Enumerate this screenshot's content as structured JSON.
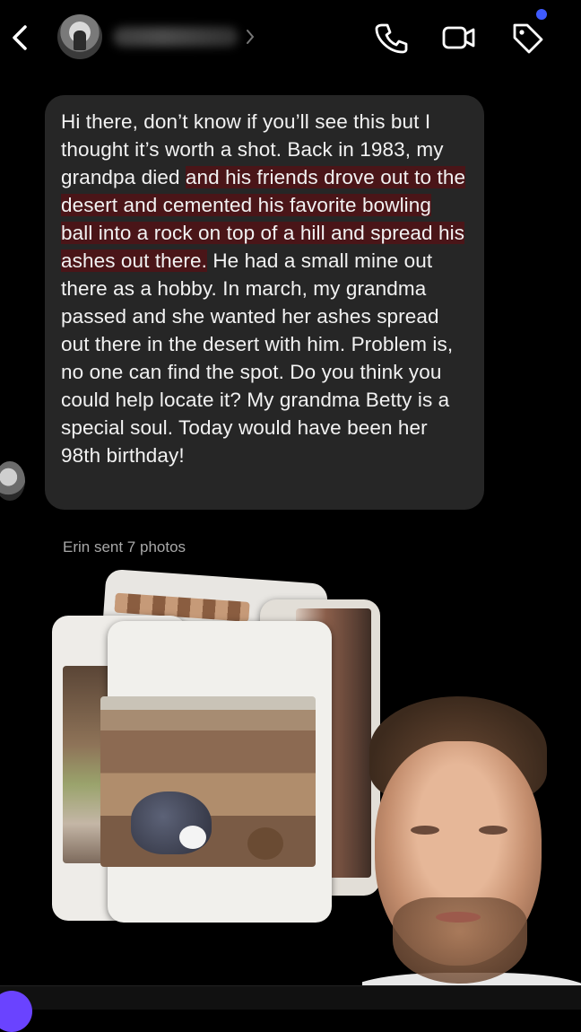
{
  "header": {
    "back_icon": "chevron-left-icon",
    "contact_name": "",
    "actions": [
      "phone-icon",
      "video-icon",
      "tag-icon"
    ],
    "notification_dot_color": "#3f5bff"
  },
  "message": {
    "text_before": "Hi there, don’t know if you’ll see this but I thought it’s worth a shot. Back in 1983, my grandpa died ",
    "text_highlight": "and his friends drove out to the desert and cemented his favorite bowling ball into a rock on top of a hill and spread his ashes out there.",
    "text_after": " He had a small mine out there as a hobby. In march, my grandma passed and she wanted her ashes spread out there in the desert with him. Problem is, no one can find the spot. Do you think you could help locate it? My grandma Betty is a special soul. Today would have been her 98th birthday!",
    "highlight_color": "#4a1518"
  },
  "photos": {
    "label": "Erin sent 7 photos"
  },
  "colors": {
    "background": "#000000",
    "bubble": "#262626",
    "accent": "#6a43ff"
  }
}
